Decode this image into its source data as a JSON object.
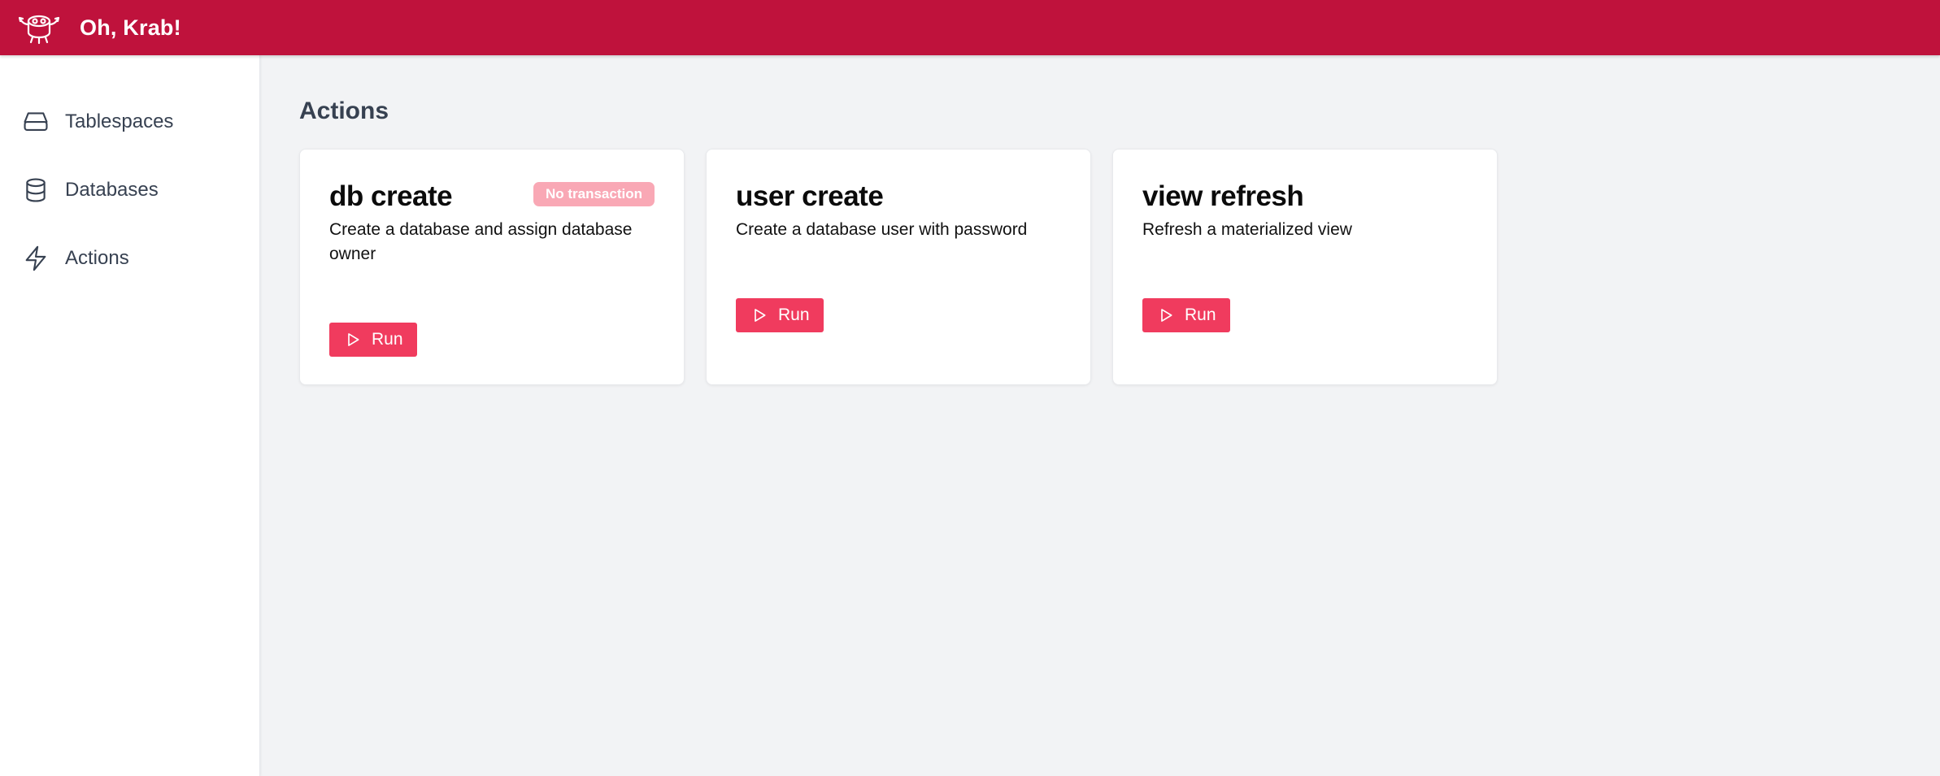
{
  "app": {
    "title": "Oh, Krab!"
  },
  "sidebar": {
    "items": [
      {
        "label": "Tablespaces",
        "icon": "drive-icon"
      },
      {
        "label": "Databases",
        "icon": "database-icon"
      },
      {
        "label": "Actions",
        "icon": "lightning-icon"
      }
    ]
  },
  "main": {
    "title": "Actions",
    "cards": [
      {
        "title": "db create",
        "badge": "No transaction",
        "description": "Create a database and assign database owner",
        "button_label": "Run"
      },
      {
        "title": "user create",
        "description": "Create a database user with password",
        "button_label": "Run"
      },
      {
        "title": "view refresh",
        "description": "Refresh a materialized view",
        "button_label": "Run"
      }
    ]
  },
  "colors": {
    "header_bg": "#bf123c",
    "button_bg": "#f03b5e",
    "badge_bg": "#f9a8b5",
    "page_bg": "#f2f3f5"
  }
}
